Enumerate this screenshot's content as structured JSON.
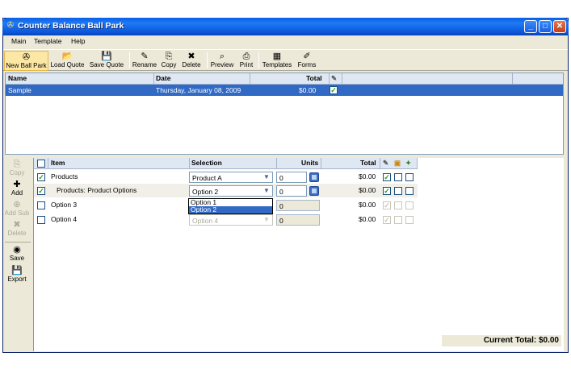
{
  "window": {
    "title": "Counter Balance Ball Park",
    "controls": {
      "minimize": "_",
      "maximize": "□",
      "close": "✕"
    }
  },
  "menu": [
    "Main",
    "Template",
    "Help"
  ],
  "toolbar": [
    {
      "label": "New Ball Park",
      "icon": "new-ballpark-icon",
      "glyph": "✇"
    },
    {
      "label": "Load Quote",
      "icon": "folder-open-icon",
      "glyph": "📂"
    },
    {
      "label": "Save Quote",
      "icon": "floppy-disk-icon",
      "glyph": "💾"
    },
    {
      "label": "Rename",
      "icon": "rename-icon",
      "glyph": "✎"
    },
    {
      "label": "Copy",
      "icon": "copy-icon",
      "glyph": "⎘"
    },
    {
      "label": "Delete",
      "icon": "delete-icon",
      "glyph": "✖"
    },
    {
      "label": "Preview",
      "icon": "preview-icon",
      "glyph": "⌕"
    },
    {
      "label": "Print",
      "icon": "print-icon",
      "glyph": "⎙"
    },
    {
      "label": "Templates",
      "icon": "templates-icon",
      "glyph": "▦"
    },
    {
      "label": "Forms",
      "icon": "forms-icon",
      "glyph": "✐"
    }
  ],
  "quotes": {
    "headers": {
      "name": "Name",
      "date": "Date",
      "total": "Total"
    },
    "rows": [
      {
        "name": "Sample",
        "date": "Thursday, January 08, 2009",
        "total": "$0.00",
        "checked": "✓"
      }
    ]
  },
  "sidebar": [
    {
      "label": "Copy",
      "icon": "copy-icon",
      "glyph": "⎘",
      "enabled": false
    },
    {
      "label": "Add",
      "icon": "add-item-icon",
      "glyph": "✚",
      "enabled": true
    },
    {
      "label": "Add Sub",
      "icon": "add-sub-icon",
      "glyph": "⊕",
      "enabled": false
    },
    {
      "label": "Delete",
      "icon": "delete-icon",
      "glyph": "✖",
      "enabled": false
    },
    {
      "label": "Save",
      "icon": "save-icon",
      "glyph": "◉",
      "enabled": true
    },
    {
      "label": "Export",
      "icon": "export-icon",
      "glyph": "💾",
      "enabled": true
    }
  ],
  "items": {
    "headers": {
      "item": "Item",
      "selection": "Selection",
      "units": "Units",
      "total": "Total"
    },
    "rows": [
      {
        "item": "Products",
        "selection": "Product A",
        "units": "0",
        "total": "$0.00",
        "checked": "✓"
      },
      {
        "item": "Products: Product Options",
        "selection": "Option 2",
        "units": "0",
        "total": "$0.00",
        "checked": "✓"
      },
      {
        "item": "Option 3",
        "selection": "",
        "units": "0",
        "total": "$0.00",
        "checked": ""
      },
      {
        "item": "Option 4",
        "selection": "Option 4",
        "units": "0",
        "total": "$0.00",
        "checked": ""
      }
    ],
    "dropdown_options": [
      "Option 1",
      "Option 2"
    ],
    "dropdown_selected": "Option 2"
  },
  "footer": {
    "current_total": "Current Total: $0.00"
  },
  "colors": {
    "selection": "#316ac5",
    "titlebar": "#0b54d8",
    "header": "#dfe7f2",
    "check": "#21a121"
  }
}
